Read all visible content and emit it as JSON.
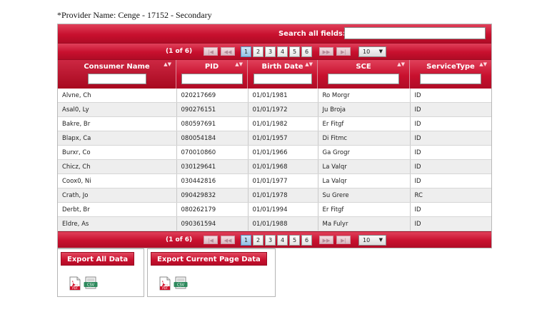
{
  "provider_label": "*Provider Name: Cenge - 17152 - Secondary",
  "search": {
    "label": "Search all fields:",
    "value": ""
  },
  "pager": {
    "count_text": "(1 of 6)",
    "first": "|◀",
    "prev": "◀◀",
    "next": "▶▶",
    "last": "▶|",
    "pages": [
      "1",
      "2",
      "3",
      "4",
      "5",
      "6"
    ],
    "current_page": "1",
    "rows_per_page": "10",
    "dropdown_arrow": "▼"
  },
  "columns": [
    {
      "title": "Consumer Name",
      "sort_icon": "sort-icon",
      "filter": ""
    },
    {
      "title": "PID",
      "sort_icon": "sort-icon",
      "filter": ""
    },
    {
      "title": "Birth Date",
      "sort_icon": "sort-icon",
      "filter": ""
    },
    {
      "title": "SCE",
      "sort_icon": "sort-icon",
      "filter": ""
    },
    {
      "title": "ServiceType",
      "sort_icon": "sort-icon",
      "filter": ""
    }
  ],
  "sort_glyph": "▲▼",
  "rows": [
    [
      "Alvne, Ch",
      "020217669",
      "01/01/1981",
      "Ro Morgr",
      "ID"
    ],
    [
      "Asal0, Ly",
      "090276151",
      "01/01/1972",
      "Ju Broja",
      "ID"
    ],
    [
      "Bakre, Br",
      "080597691",
      "01/01/1982",
      "Er Fitgf",
      "ID"
    ],
    [
      "Blapx, Ca",
      "080054184",
      "01/01/1957",
      "Di Fitmc",
      "ID"
    ],
    [
      "Burxr, Co",
      "070010860",
      "01/01/1966",
      "Ga Grogr",
      "ID"
    ],
    [
      "Chicz, Ch",
      "030129641",
      "01/01/1968",
      "La Valqr",
      "ID"
    ],
    [
      "Coox0, Ni",
      "030442816",
      "01/01/1977",
      "La Valqr",
      "ID"
    ],
    [
      "Crath, Jo",
      "090429832",
      "01/01/1978",
      "Su Grere",
      "RC"
    ],
    [
      "Derbt, Br",
      "080262179",
      "01/01/1994",
      "Er Fitgf",
      "ID"
    ],
    [
      "Eldre, As",
      "090361594",
      "01/01/1988",
      "Ma Fulyr",
      "ID"
    ]
  ],
  "export": [
    {
      "label": "Export All Data",
      "icons": [
        "pdf-icon",
        "csv-icon"
      ]
    },
    {
      "label": "Export Current Page Data",
      "icons": [
        "pdf-icon",
        "csv-icon"
      ]
    }
  ],
  "icon_text": {
    "pdf": "PDF",
    "csv": "CSV"
  },
  "colors": {
    "header_red": "#c8102e",
    "active_page": "#94c2e6",
    "row_alt": "#eeeeee"
  }
}
